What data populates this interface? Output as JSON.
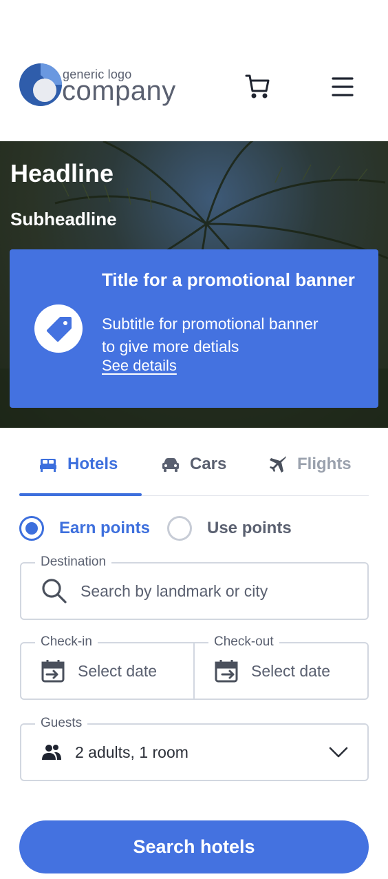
{
  "header": {
    "logo_small": "generic logo",
    "logo_big": "company",
    "cart_icon": "cart-icon",
    "menu_icon": "hamburger-menu-icon"
  },
  "hero": {
    "headline": "Headline",
    "subheadline": "Subheadline",
    "promo": {
      "icon": "price-tag-icon",
      "title": "Title for a promotional banner",
      "subtitle": "Subtitle for promotional banner to give more detials",
      "link": "See details"
    }
  },
  "tabs": [
    {
      "label": "Hotels",
      "icon": "bed-icon",
      "active": true
    },
    {
      "label": "Cars",
      "icon": "car-icon",
      "active": false
    },
    {
      "label": "Flights",
      "icon": "plane-icon",
      "active": false
    }
  ],
  "points": {
    "earn_label": "Earn points",
    "use_label": "Use points",
    "selected": "Earn points"
  },
  "form": {
    "destination": {
      "legend": "Destination",
      "placeholder": "Search by landmark or city"
    },
    "checkin": {
      "legend": "Check-in",
      "placeholder": "Select date"
    },
    "checkout": {
      "legend": "Check-out",
      "placeholder": "Select date"
    },
    "guests": {
      "legend": "Guests",
      "value": "2 adults, 1 room"
    }
  },
  "search_button": "Search hotels",
  "colors": {
    "accent": "#3d6fdd",
    "promo_bg": "#4472e0",
    "text": "#2b2f38",
    "muted": "#5a6070",
    "border": "#d2d7e0"
  }
}
